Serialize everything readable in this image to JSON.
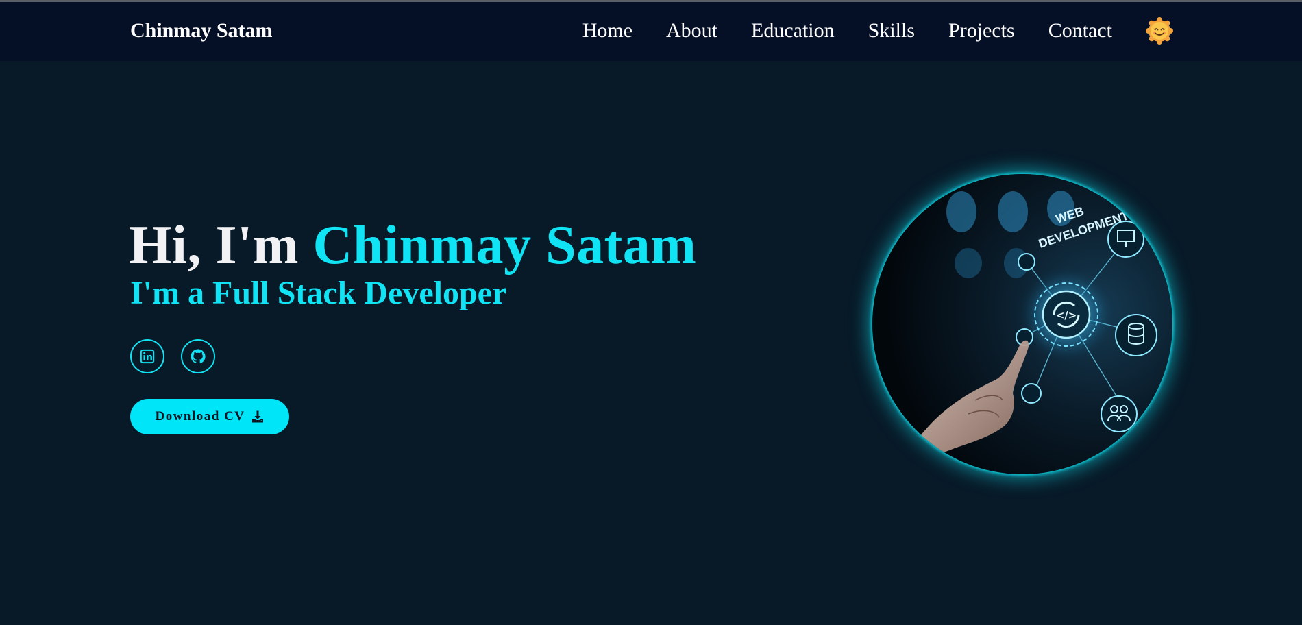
{
  "navbar": {
    "brand": "Chinmay Satam",
    "links": [
      "Home",
      "About",
      "Education",
      "Skills",
      "Projects",
      "Contact"
    ],
    "theme_toggle_icon": "smiling-sun-icon"
  },
  "hero": {
    "greeting": "Hi, I'm ",
    "name": "Chinmay Satam",
    "subtitle": "I'm a Full Stack Developer",
    "social": [
      {
        "icon": "linkedin-icon"
      },
      {
        "icon": "github-icon"
      }
    ],
    "cv_button": {
      "label": "Download CV",
      "icon": "download-icon"
    },
    "image": {
      "text_line1": "WEB",
      "text_line2": "DEVELOPMENT",
      "code_symbol": "</>"
    }
  },
  "colors": {
    "background": "#081a28",
    "navbar": "#050f26",
    "accent": "#10e4f4",
    "button": "#00e5f8",
    "text": "#ffffff"
  }
}
